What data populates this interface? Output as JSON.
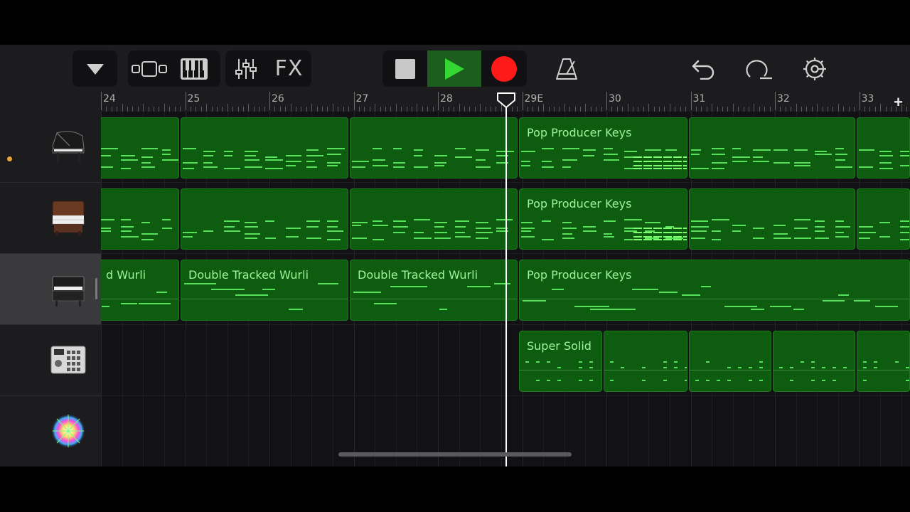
{
  "toolbar": {
    "fx_label": "FX"
  },
  "colors": {
    "region_fill": "#0e5c10",
    "note": "#58e05a",
    "record": "#ff1a1a",
    "play": "#33d633"
  },
  "ruler": {
    "bars": [
      {
        "label": "24"
      },
      {
        "label": "25"
      },
      {
        "label": "26"
      },
      {
        "label": "27"
      },
      {
        "label": "28"
      },
      {
        "label": "29E"
      },
      {
        "label": "30"
      },
      {
        "label": "31"
      },
      {
        "label": "32"
      },
      {
        "label": "33"
      }
    ],
    "add_label": "+"
  },
  "tracks": [
    {
      "instrument_icon": "grand-piano-icon",
      "recording_indicator": true
    },
    {
      "instrument_icon": "electric-organ-icon"
    },
    {
      "instrument_icon": "electric-piano-icon",
      "selected": true
    },
    {
      "instrument_icon": "drum-machine-icon"
    },
    {
      "instrument_icon": "sparkle-synth-icon"
    }
  ],
  "regions": {
    "track1": [
      {
        "name": ""
      },
      {
        "name": ""
      },
      {
        "name": ""
      },
      {
        "name": "Pop Producer Keys"
      },
      {
        "name": ""
      },
      {
        "name": ""
      }
    ],
    "track2": [
      {
        "name": ""
      },
      {
        "name": ""
      },
      {
        "name": ""
      },
      {
        "name": "Pop Producer Keys"
      },
      {
        "name": ""
      },
      {
        "name": ""
      }
    ],
    "track3": [
      {
        "name": "d Wurli"
      },
      {
        "name": "Double Tracked Wurli"
      },
      {
        "name": "Double Tracked Wurli"
      },
      {
        "name": "Pop Producer Keys"
      }
    ],
    "track4": [
      {
        "name": "Super Solid"
      },
      {
        "name": ""
      },
      {
        "name": ""
      },
      {
        "name": ""
      },
      {
        "name": ""
      }
    ]
  }
}
